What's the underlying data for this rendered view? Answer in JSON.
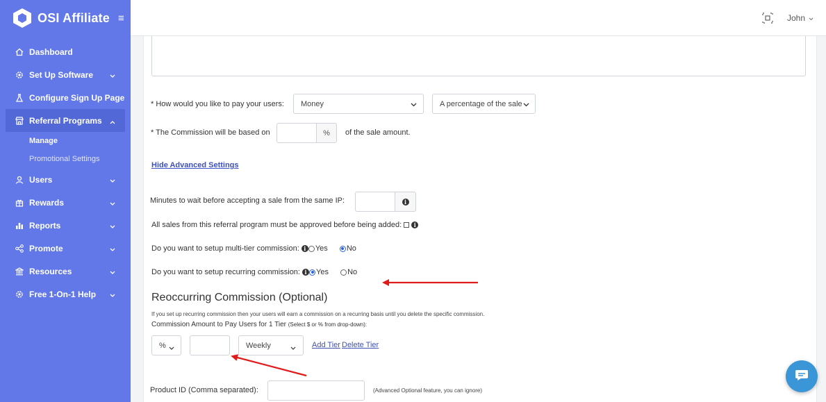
{
  "brand": {
    "name": "OSI Affiliate"
  },
  "topbar": {
    "user_name": "John"
  },
  "sidebar": {
    "items": [
      {
        "label": "Dashboard",
        "icon": "home-icon"
      },
      {
        "label": "Set Up Software",
        "icon": "gear-icon",
        "has_chevron": true
      },
      {
        "label": "Configure Sign Up Page",
        "icon": "flask-icon"
      },
      {
        "label": "Referral Programs",
        "icon": "store-icon",
        "has_chevron": true,
        "expanded": true
      },
      {
        "label": "Users",
        "icon": "user-icon",
        "has_chevron": true
      },
      {
        "label": "Rewards",
        "icon": "gift-icon",
        "has_chevron": true
      },
      {
        "label": "Reports",
        "icon": "bar-chart-icon",
        "has_chevron": true
      },
      {
        "label": "Promote",
        "icon": "share-icon",
        "has_chevron": true
      },
      {
        "label": "Resources",
        "icon": "bank-icon",
        "has_chevron": true
      },
      {
        "label": "Free 1-On-1 Help",
        "icon": "gear-icon",
        "has_chevron": true
      }
    ],
    "sub_items": [
      {
        "label": "Manage",
        "current": true
      },
      {
        "label": "Promotional Settings",
        "current": false
      }
    ]
  },
  "form": {
    "pay_label": "* How would you like to pay your users:",
    "pay_method": "Money",
    "pay_type": "A percentage of the sale",
    "commission_label": "* The Commission will be based on",
    "commission_addon": "%",
    "commission_suffix": "of the sale amount.",
    "advanced_link": "Hide Advanced Settings",
    "minutes_label": "Minutes to wait before accepting a sale from the same IP:",
    "approve_label": "All sales from this referral program must be approved before being added:",
    "multitier_label": "Do you want to setup multi-tier commission:",
    "recurring_label": "Do you want to setup recurring commission:",
    "yes": "Yes",
    "no": "No",
    "multitier_value": "No",
    "recurring_value": "Yes"
  },
  "recurring": {
    "heading": "Reoccurring Commission (Optional)",
    "note": "If you set up recurring commission then your users will earn a commission on a recurring basis until you delete the specific commission.",
    "amount_label": "Commission Amount to Pay Users for 1 Tier",
    "amount_hint": "(Select $ or % from drop-down):",
    "unit": "%",
    "frequency": "Weekly",
    "add_tier": "Add Tier",
    "delete_tier": "Delete Tier"
  },
  "product": {
    "label": "Product ID (Comma separated):",
    "hint": "(Advanced Optional feature, you can ignore)"
  },
  "colors": {
    "sidebar": "#6278e8",
    "sidebar_active": "#5268d6",
    "link": "#3f51b5",
    "annotation_arrow": "#e01b1b",
    "chat": "#3b96d8"
  }
}
